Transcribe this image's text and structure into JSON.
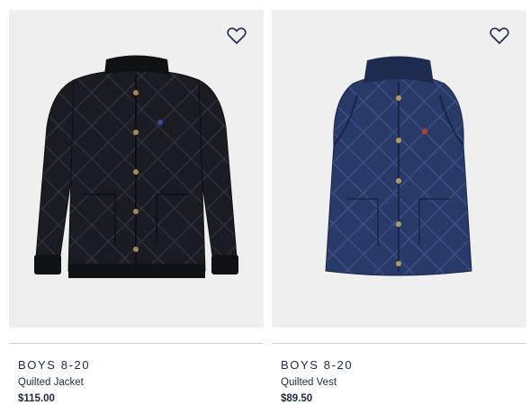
{
  "products": [
    {
      "category": "BOYS 8-20",
      "name": "Quilted Jacket",
      "price": "$115.00",
      "image_icon": "quilted-jacket-image",
      "wishlist_icon": "heart-outline-icon",
      "color": "#15171c"
    },
    {
      "category": "BOYS 8-20",
      "name": "Quilted Vest",
      "price": "$89.50",
      "image_icon": "quilted-vest-image",
      "wishlist_icon": "heart-outline-icon",
      "color": "#24345d"
    }
  ],
  "colors": {
    "image_background": "#efefef",
    "text": "#1b2a44",
    "divider": "#cfcfcf"
  }
}
